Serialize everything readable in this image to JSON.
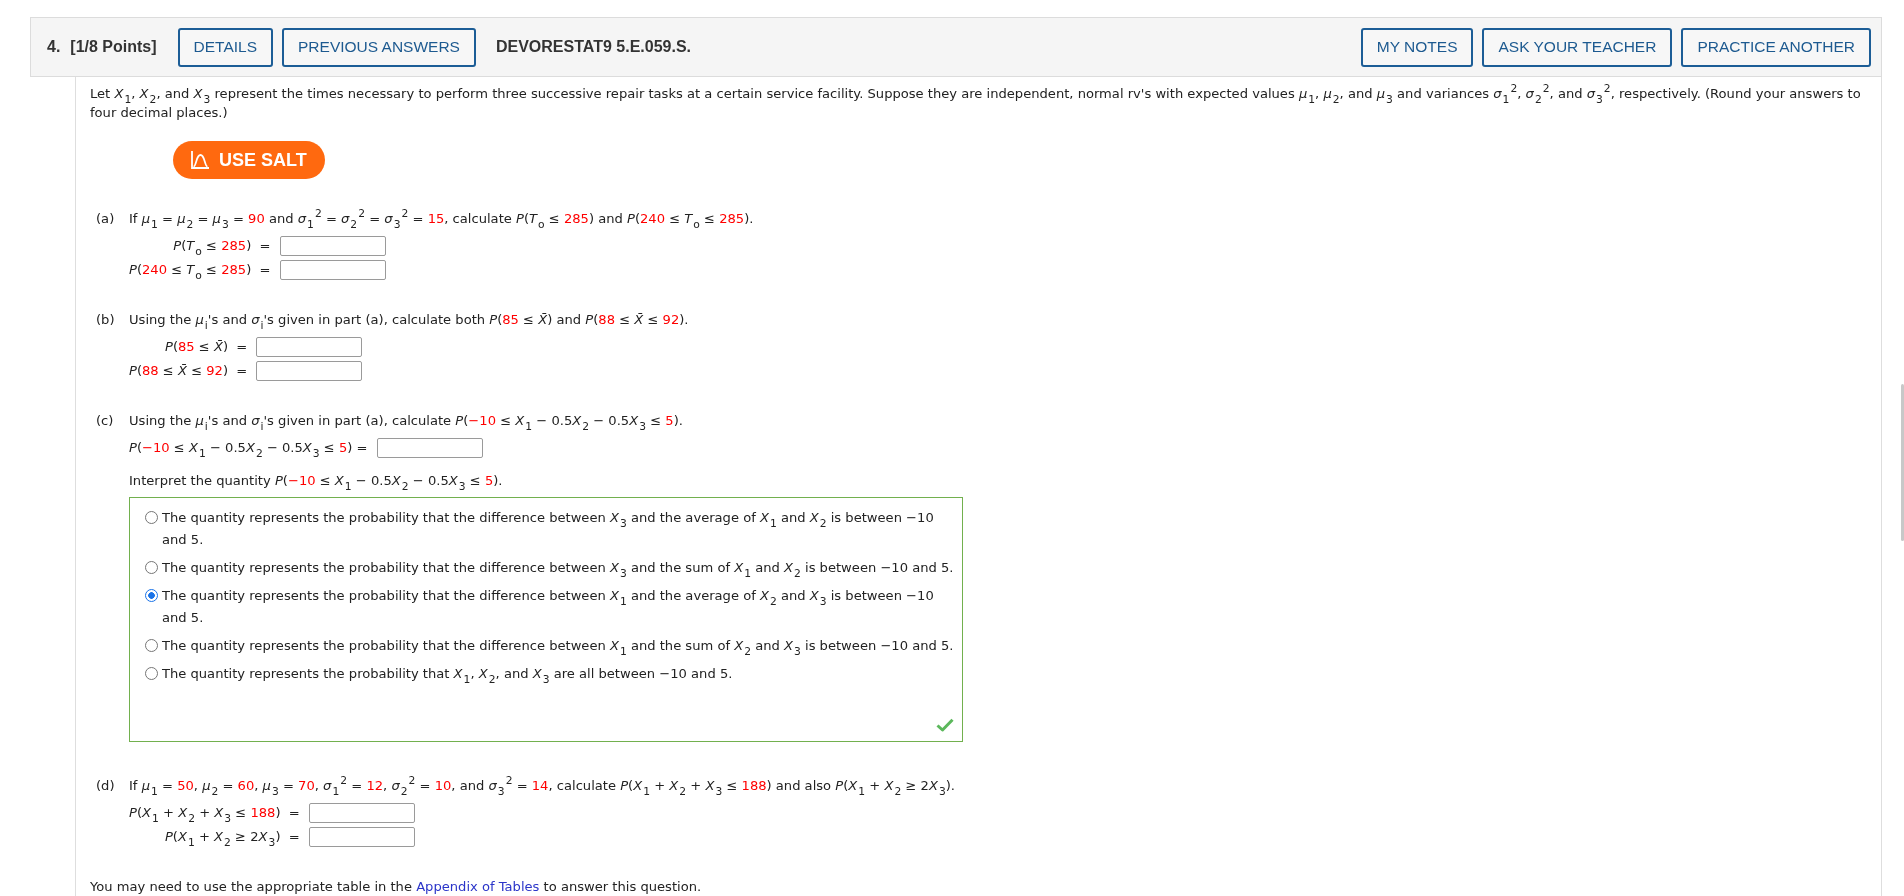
{
  "header": {
    "number": "4.",
    "points": "[1/8 Points]",
    "left_buttons": [
      "DETAILS",
      "PREVIOUS ANSWERS"
    ],
    "code": "DEVORESTAT9 5.E.059.S.",
    "right_buttons": [
      "MY NOTES",
      "ASK YOUR TEACHER",
      "PRACTICE ANOTHER"
    ]
  },
  "intro": "Let *X*$_{1}$, *X*$_{2}$, and *X*$_{3}$ represent the times necessary to perform three successive repair tasks at a certain service facility. Suppose they are independent, normal rv's with expected values *μ*$_{1}$, *μ*$_{2}$, and *μ*$_{3}$ and variances *σ*$_{1}$$^{2}$, *σ*$_{2}$$^{2}$, and *σ*$_{3}$$^{2}$, respectively. (Round your answers to four decimal places.)",
  "salt_button": {
    "label": "USE SALT"
  },
  "parts": [
    {
      "letter": "(a)",
      "prompt": [
        {
          "kind": "text",
          "text": "If *μ*$_{1}$ = *μ*$_{2}$ = *μ*$_{3}$ = "
        },
        {
          "kind": "given",
          "text": "90"
        },
        {
          "kind": "text",
          "text": " and *σ*$_{1}$$^{2}$ = *σ*$_{2}$$^{2}$ = *σ*$_{3}$$^{2}$ = "
        },
        {
          "kind": "given",
          "text": "15"
        },
        {
          "kind": "text",
          "text": ", calculate *P*(*T*$_{o}$ ≤ "
        },
        {
          "kind": "given",
          "text": "285"
        },
        {
          "kind": "text",
          "text": ") and *P*("
        },
        {
          "kind": "given",
          "text": "240"
        },
        {
          "kind": "text",
          "text": " ≤ *T*$_{o}$ ≤ "
        },
        {
          "kind": "given",
          "text": "285"
        },
        {
          "kind": "text",
          "text": ")."
        }
      ],
      "answers": [
        {
          "label": [
            {
              "kind": "text",
              "text": "*P*(*T*$_{o}$ ≤ "
            },
            {
              "kind": "given",
              "text": "285"
            },
            {
              "kind": "text",
              "text": ")  ="
            }
          ]
        },
        {
          "label": [
            {
              "kind": "text",
              "text": "*P*("
            },
            {
              "kind": "given",
              "text": "240"
            },
            {
              "kind": "text",
              "text": " ≤ *T*$_{o}$ ≤ "
            },
            {
              "kind": "given",
              "text": "285"
            },
            {
              "kind": "text",
              "text": ")  ="
            }
          ]
        }
      ]
    },
    {
      "letter": "(b)",
      "prompt": [
        {
          "kind": "text",
          "text": "Using the *μ*$_{i}$'s and *σ*$_{i}$'s given in part (a), calculate both *P*("
        },
        {
          "kind": "given",
          "text": "85"
        },
        {
          "kind": "text",
          "text": " ≤ *X̄*) and *P*("
        },
        {
          "kind": "given",
          "text": "88"
        },
        {
          "kind": "text",
          "text": " ≤ *X̄* ≤ "
        },
        {
          "kind": "given",
          "text": "92"
        },
        {
          "kind": "text",
          "text": ")."
        }
      ],
      "answers": [
        {
          "label": [
            {
              "kind": "text",
              "text": "*P*("
            },
            {
              "kind": "given",
              "text": "85"
            },
            {
              "kind": "text",
              "text": " ≤ *X̄*)  ="
            }
          ]
        },
        {
          "label": [
            {
              "kind": "text",
              "text": "*P*("
            },
            {
              "kind": "given",
              "text": "88"
            },
            {
              "kind": "text",
              "text": " ≤ *X̄* ≤ "
            },
            {
              "kind": "given",
              "text": "92"
            },
            {
              "kind": "text",
              "text": ")  ="
            }
          ]
        }
      ]
    },
    {
      "letter": "(c)",
      "prompt": [
        {
          "kind": "text",
          "text": "Using the *μ*$_{i}$'s and *σ*$_{i}$'s given in part (a), calculate *P*("
        },
        {
          "kind": "given",
          "text": "−10"
        },
        {
          "kind": "text",
          "text": " ≤ *X*$_{1}$ − 0.5"
        },
        {
          "kind": "text",
          "text": "*X*$_{2}$ − 0.5"
        },
        {
          "kind": "text",
          "text": "*X*$_{3}$ ≤ "
        },
        {
          "kind": "given",
          "text": "5"
        },
        {
          "kind": "text",
          "text": ")."
        }
      ],
      "answers": [
        {
          "label": [
            {
              "kind": "text",
              "text": "*P*("
            },
            {
              "kind": "given",
              "text": "−10"
            },
            {
              "kind": "text",
              "text": " ≤ *X*$_{1}$ − 0.5"
            },
            {
              "kind": "text",
              "text": "*X*$_{2}$ − 0.5"
            },
            {
              "kind": "text",
              "text": "*X*$_{3}$ ≤ "
            },
            {
              "kind": "given",
              "text": "5"
            },
            {
              "kind": "text",
              "text": ") ="
            }
          ]
        }
      ],
      "interpret": [
        {
          "kind": "text",
          "text": "Interpret the quantity *P*("
        },
        {
          "kind": "given",
          "text": "−10"
        },
        {
          "kind": "text",
          "text": " ≤ *X*$_{1}$ − 0.5"
        },
        {
          "kind": "text",
          "text": "*X*$_{2}$ − 0.5"
        },
        {
          "kind": "text",
          "text": "*X*$_{3}$ ≤ "
        },
        {
          "kind": "given",
          "text": "5"
        },
        {
          "kind": "text",
          "text": ")."
        }
      ],
      "choices": [
        {
          "text": "The quantity represents the probability that the difference between *X*$_{3}$ and the average of *X*$_{1}$ and *X*$_{2}$ is between −10 and 5.",
          "selected": false
        },
        {
          "text": "The quantity represents the probability that the difference between *X*$_{3}$ and the sum of *X*$_{1}$ and *X*$_{2}$ is between −10 and 5.",
          "selected": false
        },
        {
          "text": "The quantity represents the probability that the difference between *X*$_{1}$ and the average of *X*$_{2}$ and *X*$_{3}$ is between −10 and 5.",
          "selected": true
        },
        {
          "text": "The quantity represents the probability that the difference between *X*$_{1}$ and the sum of *X*$_{2}$ and *X*$_{3}$ is between −10 and 5.",
          "selected": false
        },
        {
          "text": "The quantity represents the probability that *X*$_{1}$, *X*$_{2}$, and *X*$_{3}$ are all between −10 and 5.",
          "selected": false
        }
      ],
      "correct": true
    },
    {
      "letter": "(d)",
      "prompt": [
        {
          "kind": "text",
          "text": "If *μ*$_{1}$ = "
        },
        {
          "kind": "given",
          "text": "50"
        },
        {
          "kind": "text",
          "text": ", *μ*$_{2}$ = "
        },
        {
          "kind": "given",
          "text": "60"
        },
        {
          "kind": "text",
          "text": ", *μ*$_{3}$ = "
        },
        {
          "kind": "given",
          "text": "70"
        },
        {
          "kind": "text",
          "text": ", *σ*$_{1}$$^{2}$ = "
        },
        {
          "kind": "given",
          "text": "12"
        },
        {
          "kind": "text",
          "text": ", *σ*$_{2}$$^{2}$ = "
        },
        {
          "kind": "given",
          "text": "10"
        },
        {
          "kind": "text",
          "text": ", and *σ*$_{3}$$^{2}$ = "
        },
        {
          "kind": "given",
          "text": "14"
        },
        {
          "kind": "text",
          "text": ", calculate *P*(*X*$_{1}$ + *X*$_{2}$ + *X*$_{3}$ ≤ "
        },
        {
          "kind": "given",
          "text": "188"
        },
        {
          "kind": "text",
          "text": ") and also *P*(*X*$_{1}$ + *X*$_{2}$ ≥ 2"
        },
        {
          "kind": "text",
          "text": "*X*$_{3}$)."
        }
      ],
      "answers": [
        {
          "label": [
            {
              "kind": "text",
              "text": "*P*(*X*$_{1}$ + *X*$_{2}$ + *X*$_{3}$ ≤ "
            },
            {
              "kind": "given",
              "text": "188"
            },
            {
              "kind": "text",
              "text": ")  ="
            }
          ]
        },
        {
          "label": [
            {
              "kind": "text",
              "text": "*P*(*X*$_{1}$ + *X*$_{2}$ ≥ 2"
            },
            {
              "kind": "text",
              "text": "*X*$_{3}$)  ="
            }
          ]
        }
      ]
    }
  ],
  "footer": {
    "before": "You may need to use the appropriate table in the",
    "link": "Appendix of Tables",
    "after": "to answer this question."
  }
}
